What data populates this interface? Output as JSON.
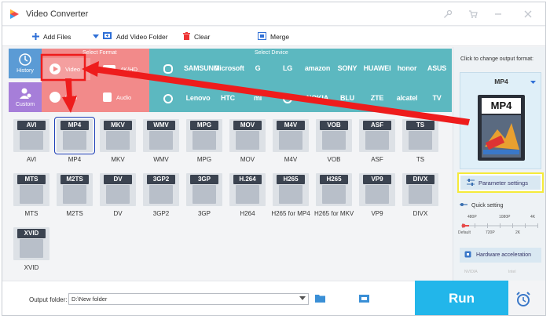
{
  "app": {
    "title": "Video Converter"
  },
  "toolbar": {
    "add_files": "Add Files",
    "add_video_folder": "Add Video Folder",
    "clear": "Clear",
    "merge": "Merge"
  },
  "side": {
    "history": "History",
    "custom": "Custom"
  },
  "sections": {
    "select_format": "Select Format",
    "select_device": "Select Device"
  },
  "format_tabs": {
    "video": "Video",
    "hd": "4K/HD",
    "web": "Web",
    "audio": "Audio"
  },
  "devices_row1": [
    "",
    "SAMSUNG",
    "Microsoft",
    "G",
    "LG",
    "amazon",
    "SONY",
    "HUAWEI",
    "honor",
    "ASUS"
  ],
  "devices_row2": [
    "",
    "Lenovo",
    "HTC",
    "mi",
    "",
    "NOKIA",
    "BLU",
    "ZTE",
    "alcatel",
    "TV"
  ],
  "formats": [
    {
      "badge": "AVI",
      "label": "AVI"
    },
    {
      "badge": "MP4",
      "label": "MP4"
    },
    {
      "badge": "MKV",
      "label": "MKV"
    },
    {
      "badge": "WMV",
      "label": "WMV"
    },
    {
      "badge": "MPG",
      "label": "MPG"
    },
    {
      "badge": "MOV",
      "label": "MOV"
    },
    {
      "badge": "M4V",
      "label": "M4V"
    },
    {
      "badge": "VOB",
      "label": "VOB"
    },
    {
      "badge": "ASF",
      "label": "ASF"
    },
    {
      "badge": "TS",
      "label": "TS"
    },
    {
      "badge": "MTS",
      "label": "MTS"
    },
    {
      "badge": "M2TS",
      "label": "M2TS"
    },
    {
      "badge": "DV",
      "label": "DV"
    },
    {
      "badge": "3GP2",
      "label": "3GP2"
    },
    {
      "badge": "3GP",
      "label": "3GP"
    },
    {
      "badge": "H.264",
      "label": "H264"
    },
    {
      "badge": "H265",
      "label": "H265 for MP4"
    },
    {
      "badge": "H265",
      "label": "H265 for MKV"
    },
    {
      "badge": "VP9",
      "label": "VP9"
    },
    {
      "badge": "DIVX",
      "label": "DIVX"
    },
    {
      "badge": "XVID",
      "label": "XVID"
    }
  ],
  "selected_format": "MP4",
  "right_panel": {
    "title": "Click to change output format:",
    "format_name": "MP4",
    "format_badge": "MP4",
    "param_settings": "Parameter settings",
    "quick_setting": "Quick setting",
    "ticks_top": [
      "480P",
      "1080P",
      "4K"
    ],
    "ticks_bottom": [
      "Default",
      "720P",
      "2K"
    ],
    "hw_accel": "Hardware acceleration",
    "vendors": [
      "NVIDIA",
      "Intel"
    ]
  },
  "output": {
    "label": "Output folder:",
    "path": "D:\\New folder"
  },
  "run_label": "Run",
  "colors": {
    "format_panel": "#f28a8a",
    "device_panel": "#5cb8c0",
    "side_history": "#5b9bd5",
    "side_custom": "#a67ed9",
    "run": "#22b6ea",
    "annotation_red": "#ee1c1c",
    "annotation_blue": "#1e3fb8",
    "annotation_yellow": "#f5ea3a"
  }
}
